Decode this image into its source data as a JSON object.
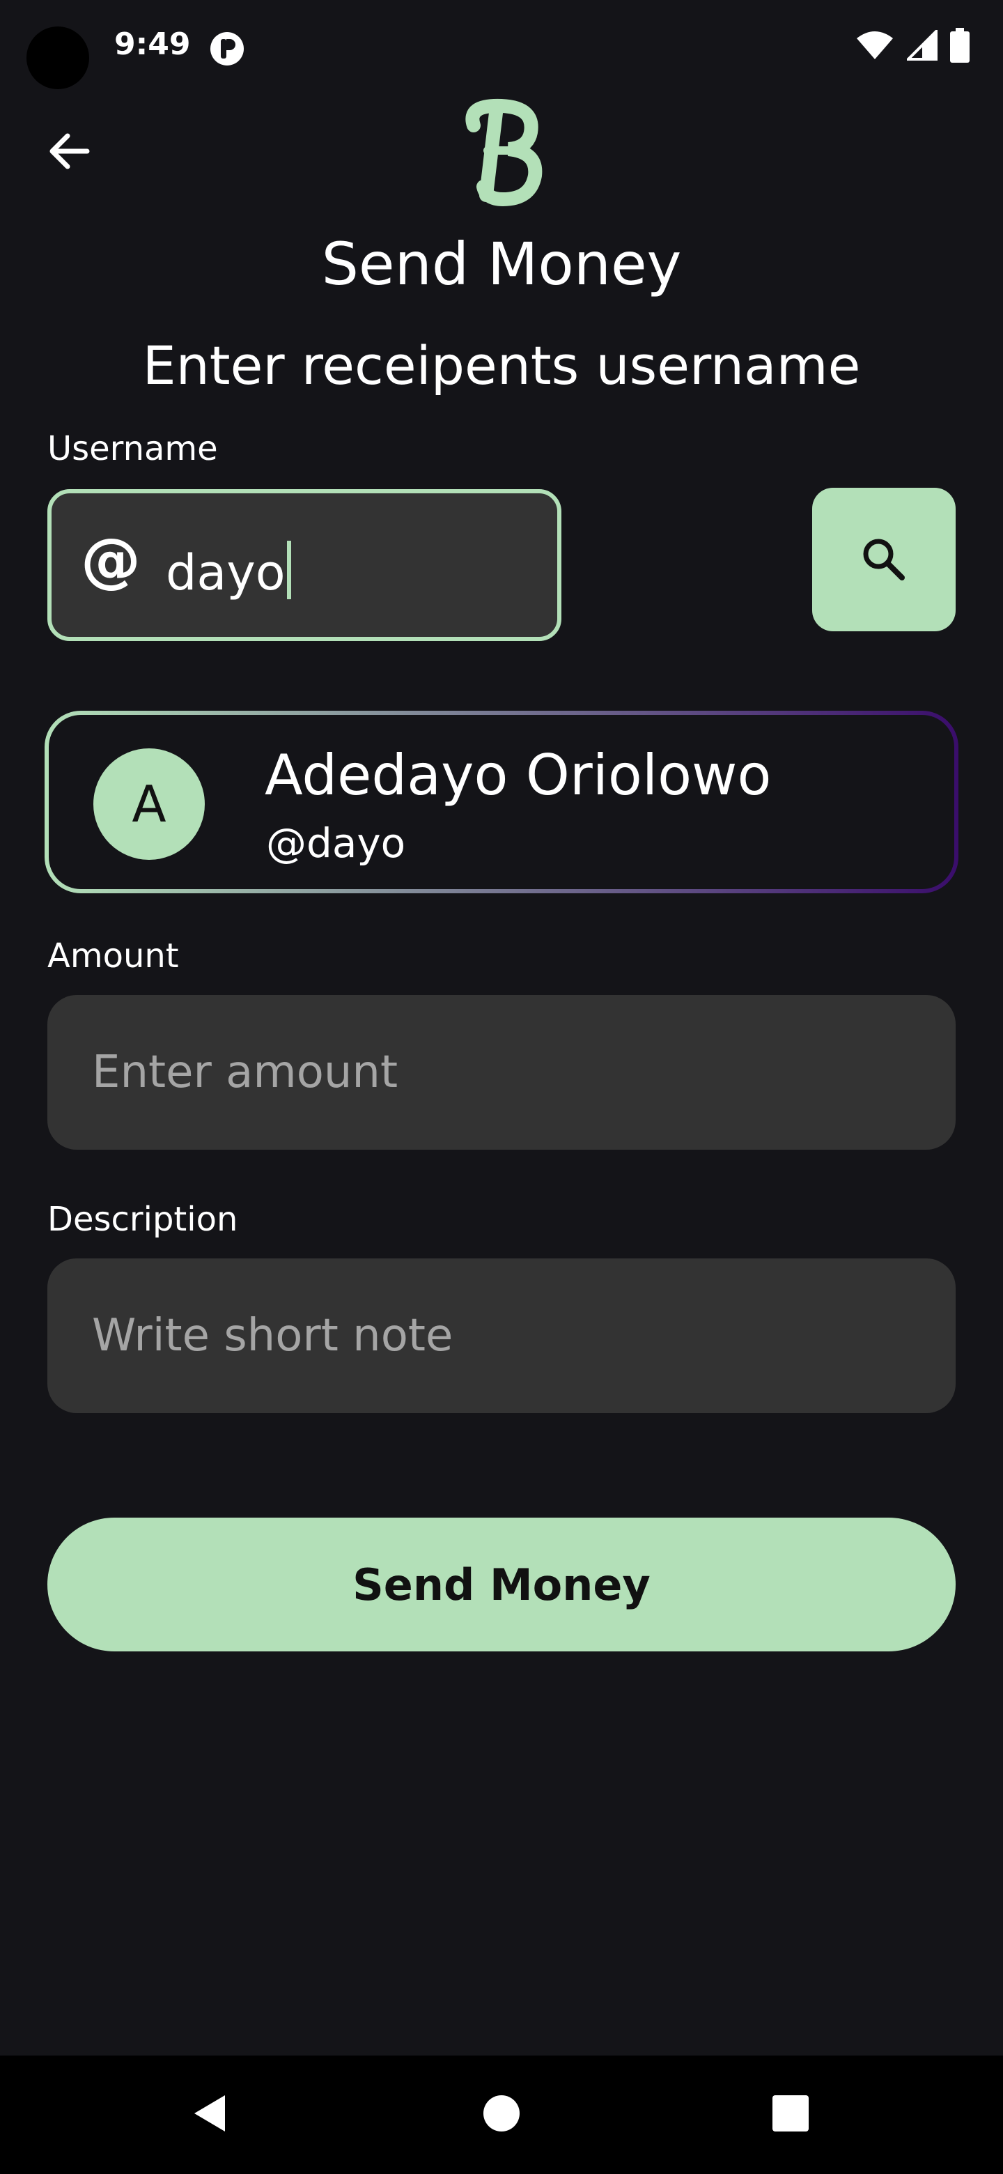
{
  "status_bar": {
    "time": "9:49"
  },
  "header": {
    "title": "Send Money",
    "subtitle": "Enter receipents username"
  },
  "username": {
    "label": "Username",
    "prefix": "@",
    "value": "dayo"
  },
  "recipient": {
    "avatar_initial": "A",
    "name": "Adedayo Oriolowo",
    "handle": "@dayo"
  },
  "amount": {
    "label": "Amount",
    "placeholder": "Enter amount"
  },
  "description": {
    "label": "Description",
    "placeholder": "Write short note"
  },
  "send_button": {
    "label": "Send Money"
  },
  "colors": {
    "background": "#141418",
    "accent": "#b3e0b8",
    "input_bg": "#333333",
    "card_gradient_end": "#3a0d6b"
  },
  "icons": {
    "back": "arrow-left-icon",
    "logo": "app-logo-b",
    "search": "search-icon",
    "nav_back": "triangle-back-icon",
    "nav_home": "circle-home-icon",
    "nav_recents": "square-recents-icon"
  }
}
